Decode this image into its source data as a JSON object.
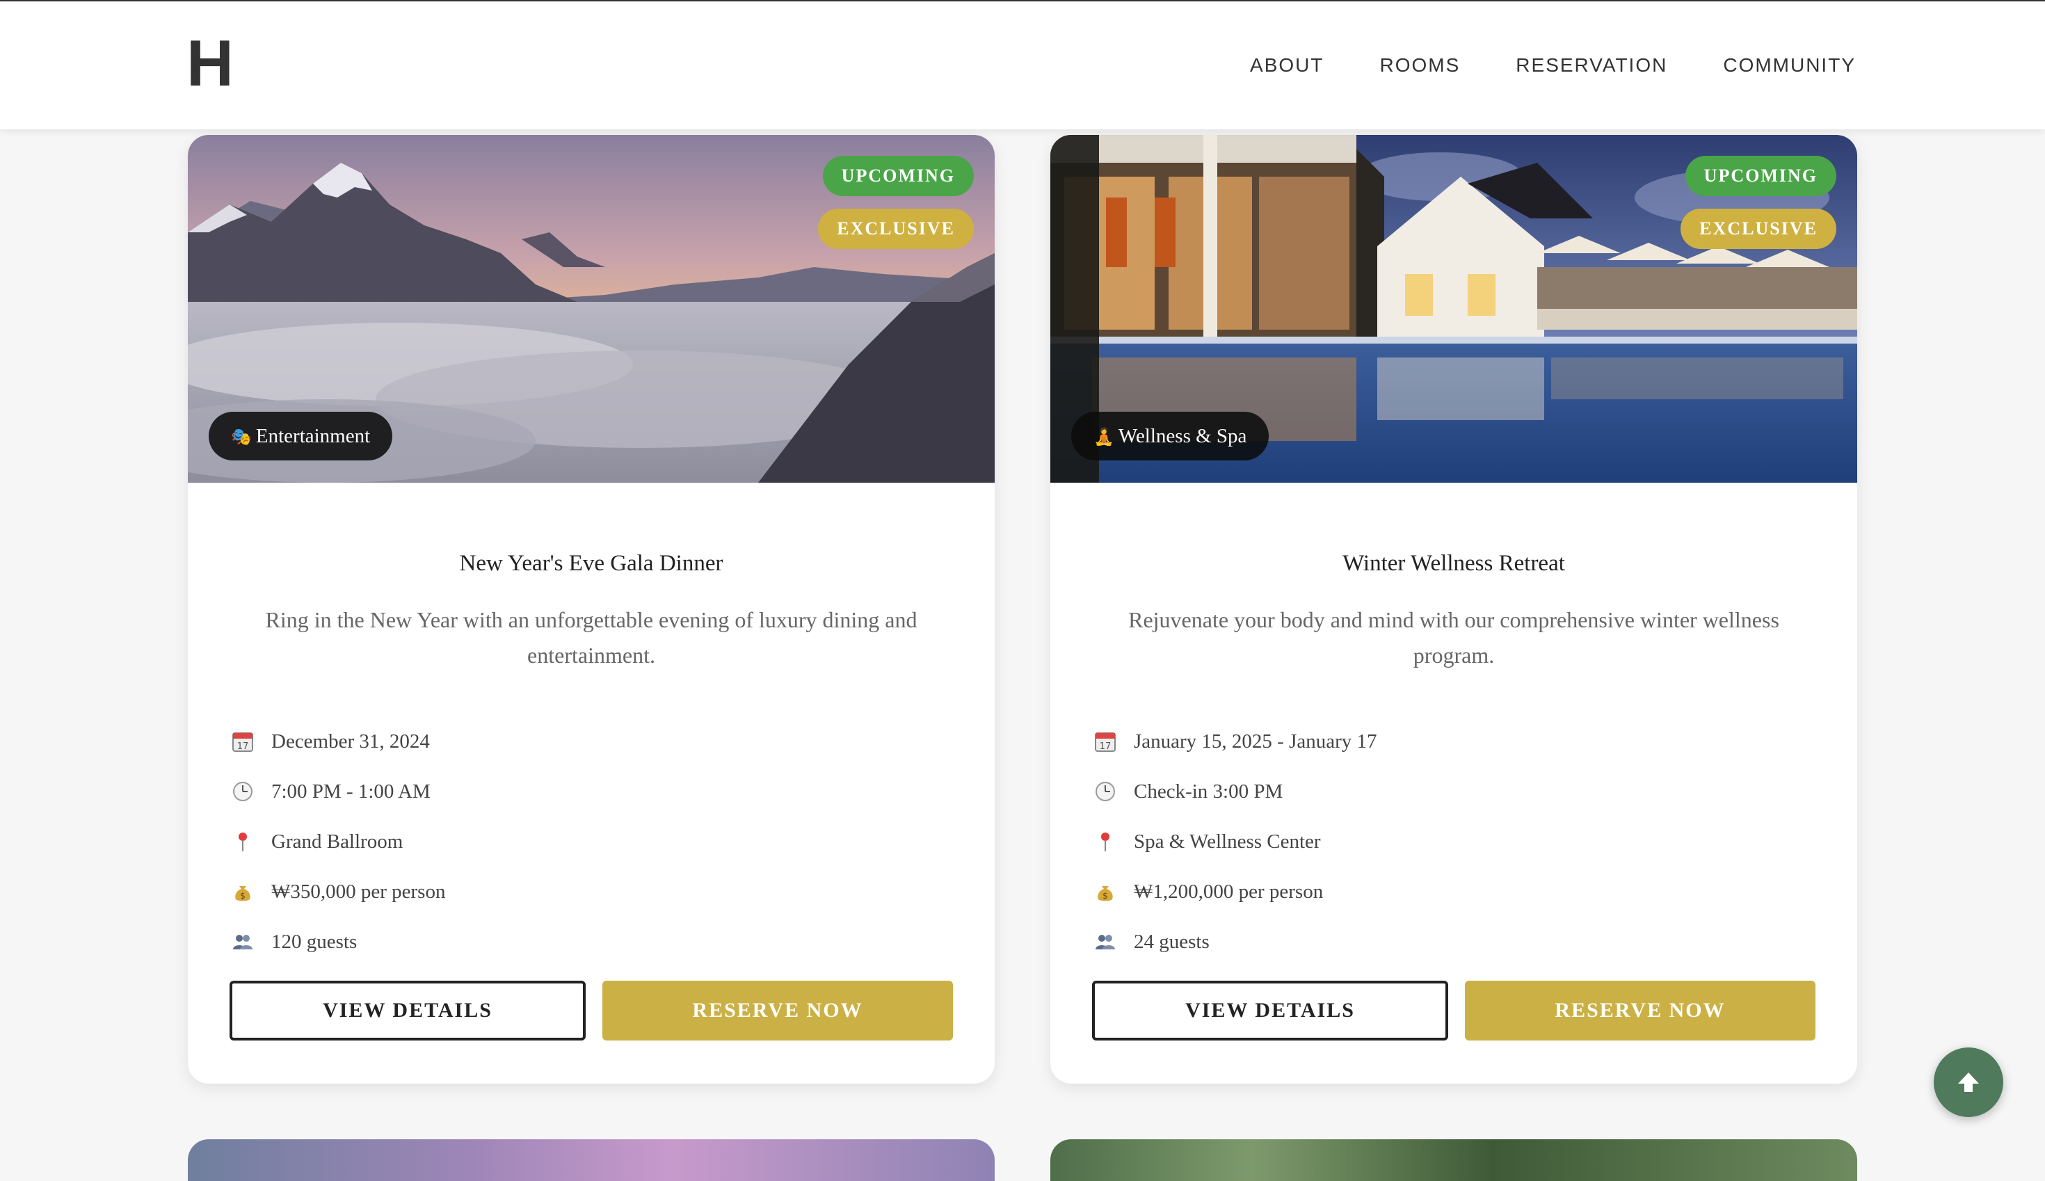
{
  "header": {
    "logo": "H",
    "nav": [
      "ABOUT",
      "ROOMS",
      "RESERVATION",
      "COMMUNITY"
    ]
  },
  "events": [
    {
      "badges": {
        "upcoming": "UPCOMING",
        "exclusive": "EXCLUSIVE"
      },
      "category": "Entertainment",
      "category_icon": "theater-masks-icon",
      "title": "New Year's Eve Gala Dinner",
      "description": "Ring in the New Year with an unforgettable evening of luxury dining and entertainment.",
      "date": "December 31, 2024",
      "time": "7:00 PM - 1:00 AM",
      "location": "Grand Ballroom",
      "price": "₩350,000 per person",
      "capacity": "120 guests",
      "view_label": "VIEW DETAILS",
      "reserve_label": "RESERVE NOW"
    },
    {
      "badges": {
        "upcoming": "UPCOMING",
        "exclusive": "EXCLUSIVE"
      },
      "category": "Wellness & Spa",
      "category_icon": "meditation-icon",
      "title": "Winter Wellness Retreat",
      "description": "Rejuvenate your body and mind with our comprehensive winter wellness program.",
      "date": "January 15, 2025 - January 17",
      "time": "Check-in 3:00 PM",
      "location": "Spa & Wellness Center",
      "price": "₩1,200,000 per person",
      "capacity": "24 guests",
      "view_label": "VIEW DETAILS",
      "reserve_label": "RESERVE NOW"
    }
  ],
  "colors": {
    "upcoming_badge": "#4aa548",
    "exclusive_badge": "#cfb142",
    "reserve_button": "#cbb045",
    "scroll_top_button": "#4f7a5c"
  }
}
